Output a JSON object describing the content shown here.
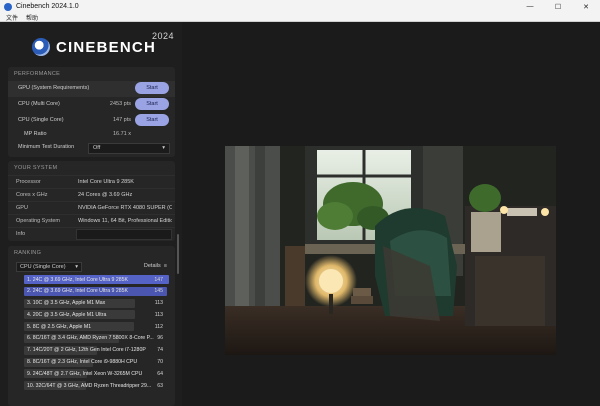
{
  "window": {
    "title": "Cinebench 2024.1.0",
    "minimize": "—",
    "maximize": "☐",
    "close": "✕"
  },
  "menu": [
    "文件",
    "帮助"
  ],
  "logo": {
    "word": "CINEBENCH",
    "version": "2024"
  },
  "performance": {
    "title": "PERFORMANCE",
    "rows": [
      {
        "label": "GPU (System Requirements)",
        "value": "",
        "button": "Start"
      },
      {
        "label": "CPU (Multi Core)",
        "value": "2453 pts",
        "button": "Start"
      },
      {
        "label": "CPU (Single Core)",
        "value": "147 pts",
        "button": "Start"
      }
    ],
    "mp_label": "MP Ratio",
    "mp_value": "16.71 x",
    "duration_label": "Minimum Test Duration",
    "duration_value": "Off"
  },
  "system": {
    "title": "YOUR SYSTEM",
    "rows": [
      {
        "k": "Processor",
        "v": "Intel Core Ultra 9 285K"
      },
      {
        "k": "Cores x GHz",
        "v": "24 Cores @ 3.69 GHz"
      },
      {
        "k": "GPU",
        "v": "NVIDIA GeForce RTX 4080 SUPER (CU..."
      },
      {
        "k": "Operating System",
        "v": "Windows 11, 64 Bit, Professional Editio..."
      },
      {
        "k": "Info",
        "v": ""
      }
    ]
  },
  "ranking": {
    "title": "RANKING",
    "select": "CPU (Single Core)",
    "details": "Details",
    "items": [
      {
        "text": "1. 24C @ 3.69 GHz, Intel Core Ultra 9 285K",
        "score": "147",
        "max": 147,
        "kind": "mine"
      },
      {
        "text": "2. 24C @ 3.69 GHz, Intel Core Ultra 9 285K",
        "score": "145",
        "max": 145,
        "kind": "mine2"
      },
      {
        "text": "3. 10C @ 3.5 GHz, Apple M1 Max",
        "score": "113",
        "max": 113,
        "kind": ""
      },
      {
        "text": "4. 20C @ 3.5 GHz, Apple M1 Ultra",
        "score": "113",
        "max": 113,
        "kind": ""
      },
      {
        "text": "5. 8C @ 2.5 GHz, Apple M1",
        "score": "112",
        "max": 112,
        "kind": ""
      },
      {
        "text": "6. 8C/16T @ 3.4 GHz, AMD Ryzen 7 5800X 8-Core P...",
        "score": "96",
        "max": 96,
        "kind": ""
      },
      {
        "text": "7. 14C/20T @ 2 GHz, 12th Gen Intel Core i7-1280P",
        "score": "74",
        "max": 74,
        "kind": ""
      },
      {
        "text": "8. 8C/16T @ 2.3 GHz, Intel Core i9-9880H CPU",
        "score": "70",
        "max": 70,
        "kind": ""
      },
      {
        "text": "9. 24C/48T @ 2.7 GHz, Intel Xeon W-3265M CPU",
        "score": "64",
        "max": 64,
        "kind": ""
      },
      {
        "text": "10. 32C/64T @ 3 GHz, AMD Ryzen Threadripper 29...",
        "score": "63",
        "max": 63,
        "kind": ""
      }
    ]
  }
}
